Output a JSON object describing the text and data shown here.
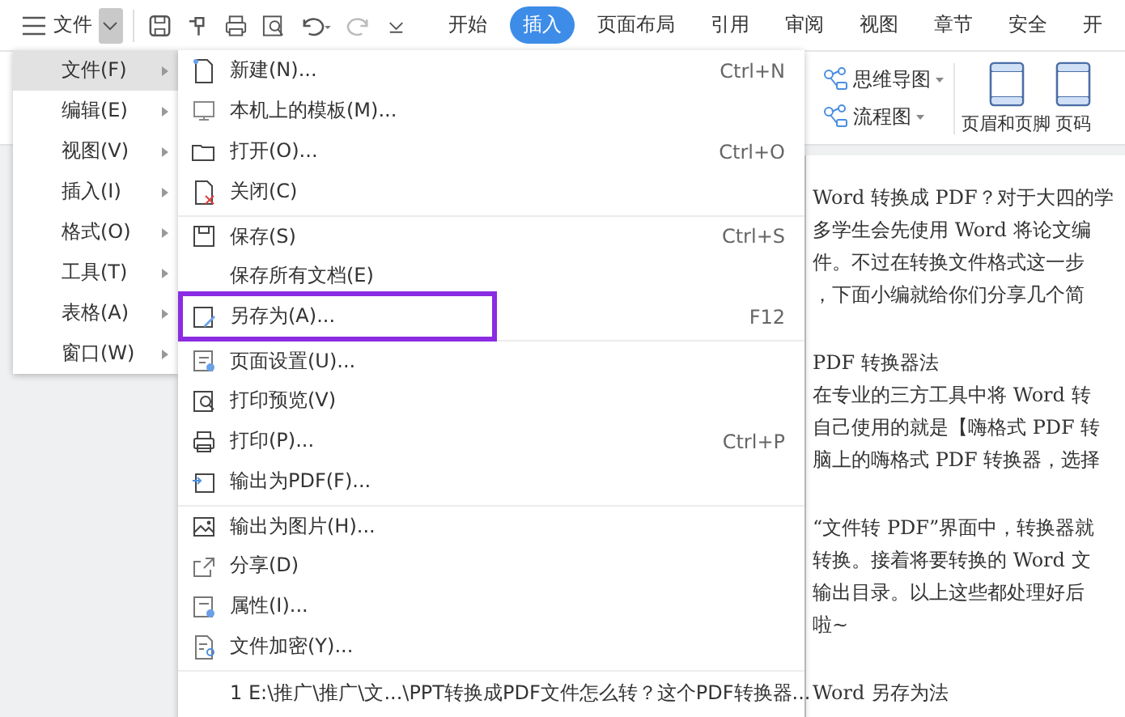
{
  "toolbar": {
    "menu_label": "文件",
    "tabs": [
      {
        "label": "开始",
        "selected": false
      },
      {
        "label": "插入",
        "selected": true
      },
      {
        "label": "页面布局",
        "selected": false
      },
      {
        "label": "引用",
        "selected": false
      },
      {
        "label": "审阅",
        "selected": false
      },
      {
        "label": "视图",
        "selected": false
      },
      {
        "label": "章节",
        "selected": false
      },
      {
        "label": "安全",
        "selected": false
      },
      {
        "label": "开",
        "selected": false
      }
    ]
  },
  "ribbon": {
    "small_buttons": [
      "思维导图",
      "流程图"
    ],
    "large_buttons": [
      "页眉和页脚",
      "页码"
    ]
  },
  "left_menu": [
    {
      "label": "文件(F)",
      "selected": true
    },
    {
      "label": "编辑(E)",
      "selected": false
    },
    {
      "label": "视图(V)",
      "selected": false
    },
    {
      "label": "插入(I)",
      "selected": false
    },
    {
      "label": "格式(O)",
      "selected": false
    },
    {
      "label": "工具(T)",
      "selected": false
    },
    {
      "label": "表格(A)",
      "selected": false
    },
    {
      "label": "窗口(W)",
      "selected": false
    }
  ],
  "file_menu": {
    "groups": [
      [
        {
          "label": "新建(N)...",
          "shortcut": "Ctrl+N",
          "selected": false
        },
        {
          "label": "本机上的模板(M)...",
          "selected": false
        },
        {
          "label": "打开(O)...",
          "shortcut": "Ctrl+O",
          "selected": false
        },
        {
          "label": "关闭(C)",
          "selected": false
        }
      ],
      [
        {
          "label": "保存(S)",
          "shortcut": "Ctrl+S",
          "selected": false
        },
        {
          "label": "保存所有文档(E)",
          "selected": false
        },
        {
          "label": "另存为(A)...",
          "shortcut": "F12",
          "selected": true
        }
      ],
      [
        {
          "label": "页面设置(U)...",
          "selected": false
        },
        {
          "label": "打印预览(V)",
          "selected": false
        },
        {
          "label": "打印(P)...",
          "shortcut": "Ctrl+P",
          "selected": false
        },
        {
          "label": "输出为PDF(F)...",
          "selected": false
        }
      ],
      [
        {
          "label": "输出为图片(H)...",
          "selected": false
        },
        {
          "label": "分享(D)",
          "selected": false
        },
        {
          "label": "属性(I)...",
          "selected": false
        },
        {
          "label": "文件加密(Y)...",
          "selected": false
        }
      ]
    ],
    "recent": "1 E:\\推广\\推广\\文...\\PPT转换成PDF文件怎么转？这个PDF转换器..."
  },
  "document": {
    "paragraphs": [
      [
        "Word 转换成 PDF？对于大四的学",
        "多学生会先使用 Word 将论文编",
        "件。不过在转换文件格式这一步",
        "，下面小编就给你们分享几个简"
      ],
      [
        "PDF 转换器法",
        "在专业的三方工具中将 Word 转",
        "自己使用的就是【嗨格式 PDF 转",
        "脑上的嗨格式 PDF 转换器，选择"
      ],
      [
        "“文件转 PDF”界面中，转换器就",
        "转换。接着将要转换的 Word 文",
        "输出目录。以上这些都处理好后",
        "啦~"
      ],
      [
        "Word 另存为法"
      ]
    ]
  }
}
